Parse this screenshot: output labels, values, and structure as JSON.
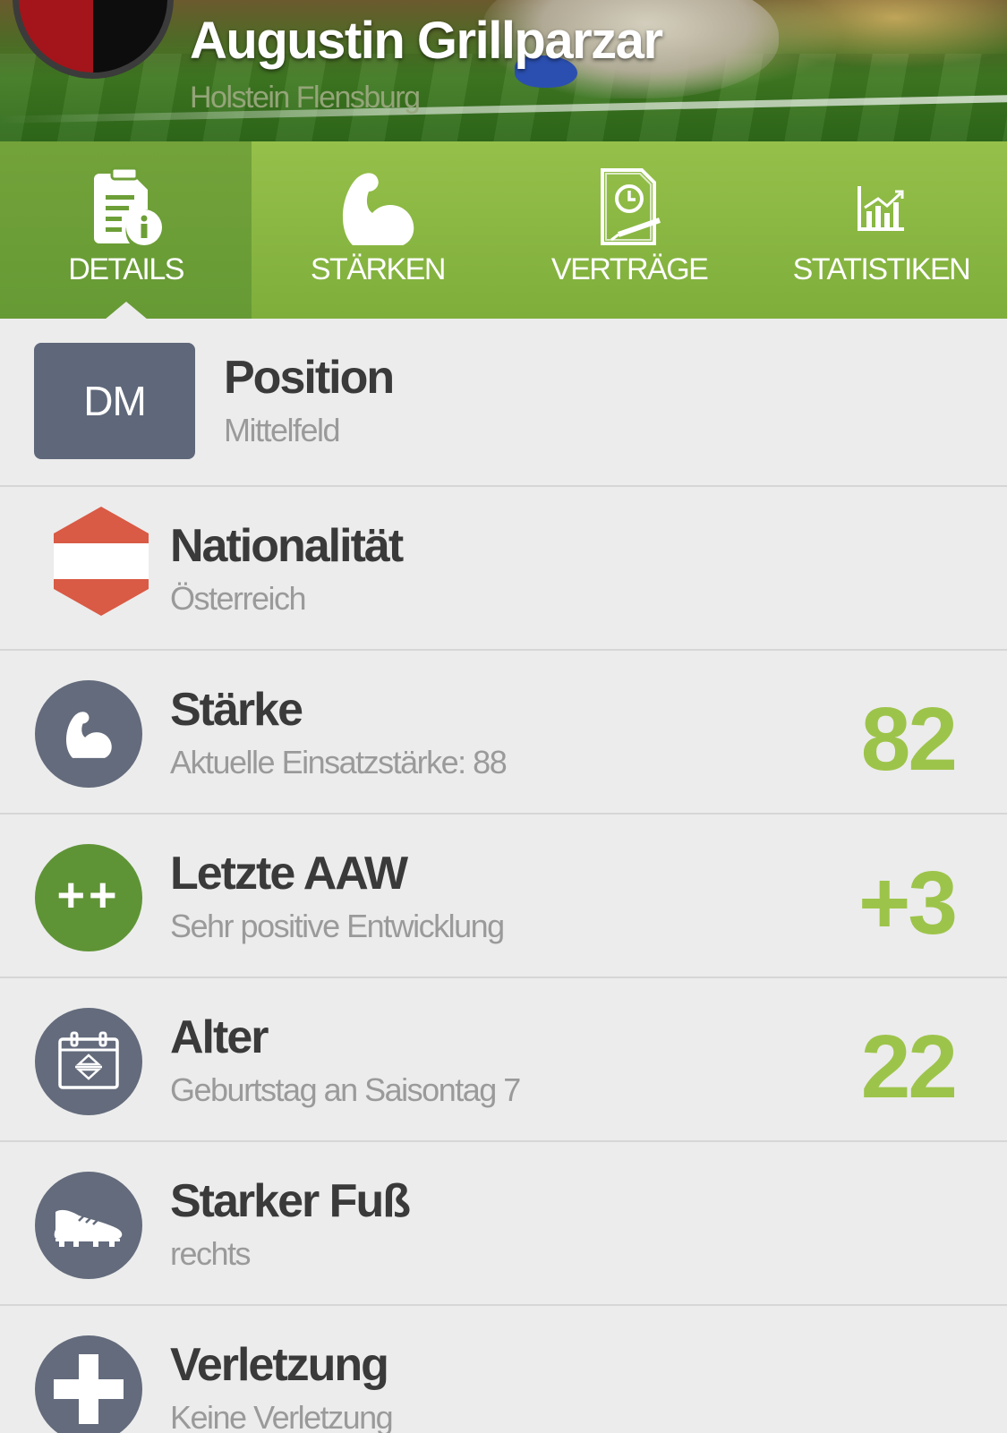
{
  "header": {
    "player_name": "Augustin Grillparzar",
    "club_name": "Holstein Flensburg"
  },
  "tabs": [
    {
      "label": "DETAILS",
      "icon": "document-info-icon",
      "active": true
    },
    {
      "label": "STÄRKEN",
      "icon": "flexed-arm-icon",
      "active": false
    },
    {
      "label": "VERTRÄGE",
      "icon": "contract-clock-icon",
      "active": false
    },
    {
      "label": "STATISTIKEN",
      "icon": "bar-chart-icon",
      "active": false
    }
  ],
  "rows": {
    "position": {
      "badge": "DM",
      "title": "Position",
      "subtitle": "Mittelfeld"
    },
    "nationality": {
      "title": "Nationalität",
      "subtitle": "Österreich",
      "icon": "austria-flag-icon"
    },
    "strength": {
      "title": "Stärke",
      "subtitle": "Aktuelle Einsatzstärke: 88",
      "value": "82",
      "icon": "flexed-arm-icon"
    },
    "last_aaw": {
      "title": "Letzte AAW",
      "subtitle": "Sehr positive Entwicklung",
      "value": "+3",
      "icon_text": "++"
    },
    "age": {
      "title": "Alter",
      "subtitle": "Geburtstag an Saisontag 7",
      "value": "22",
      "icon": "calendar-icon"
    },
    "strong_foot": {
      "title": "Starker Fuß",
      "subtitle": "rechts",
      "icon": "football-boot-icon"
    },
    "injury": {
      "title": "Verletzung",
      "subtitle": "Keine Verletzung",
      "icon": "medical-cross-icon"
    }
  },
  "colors": {
    "tab_green": "#7fae3b",
    "tab_active": "#669a34",
    "value_green": "#9dc44a",
    "icon_slate": "#636b7c",
    "aaw_green": "#5f9436",
    "flag_red": "#d95a45"
  }
}
